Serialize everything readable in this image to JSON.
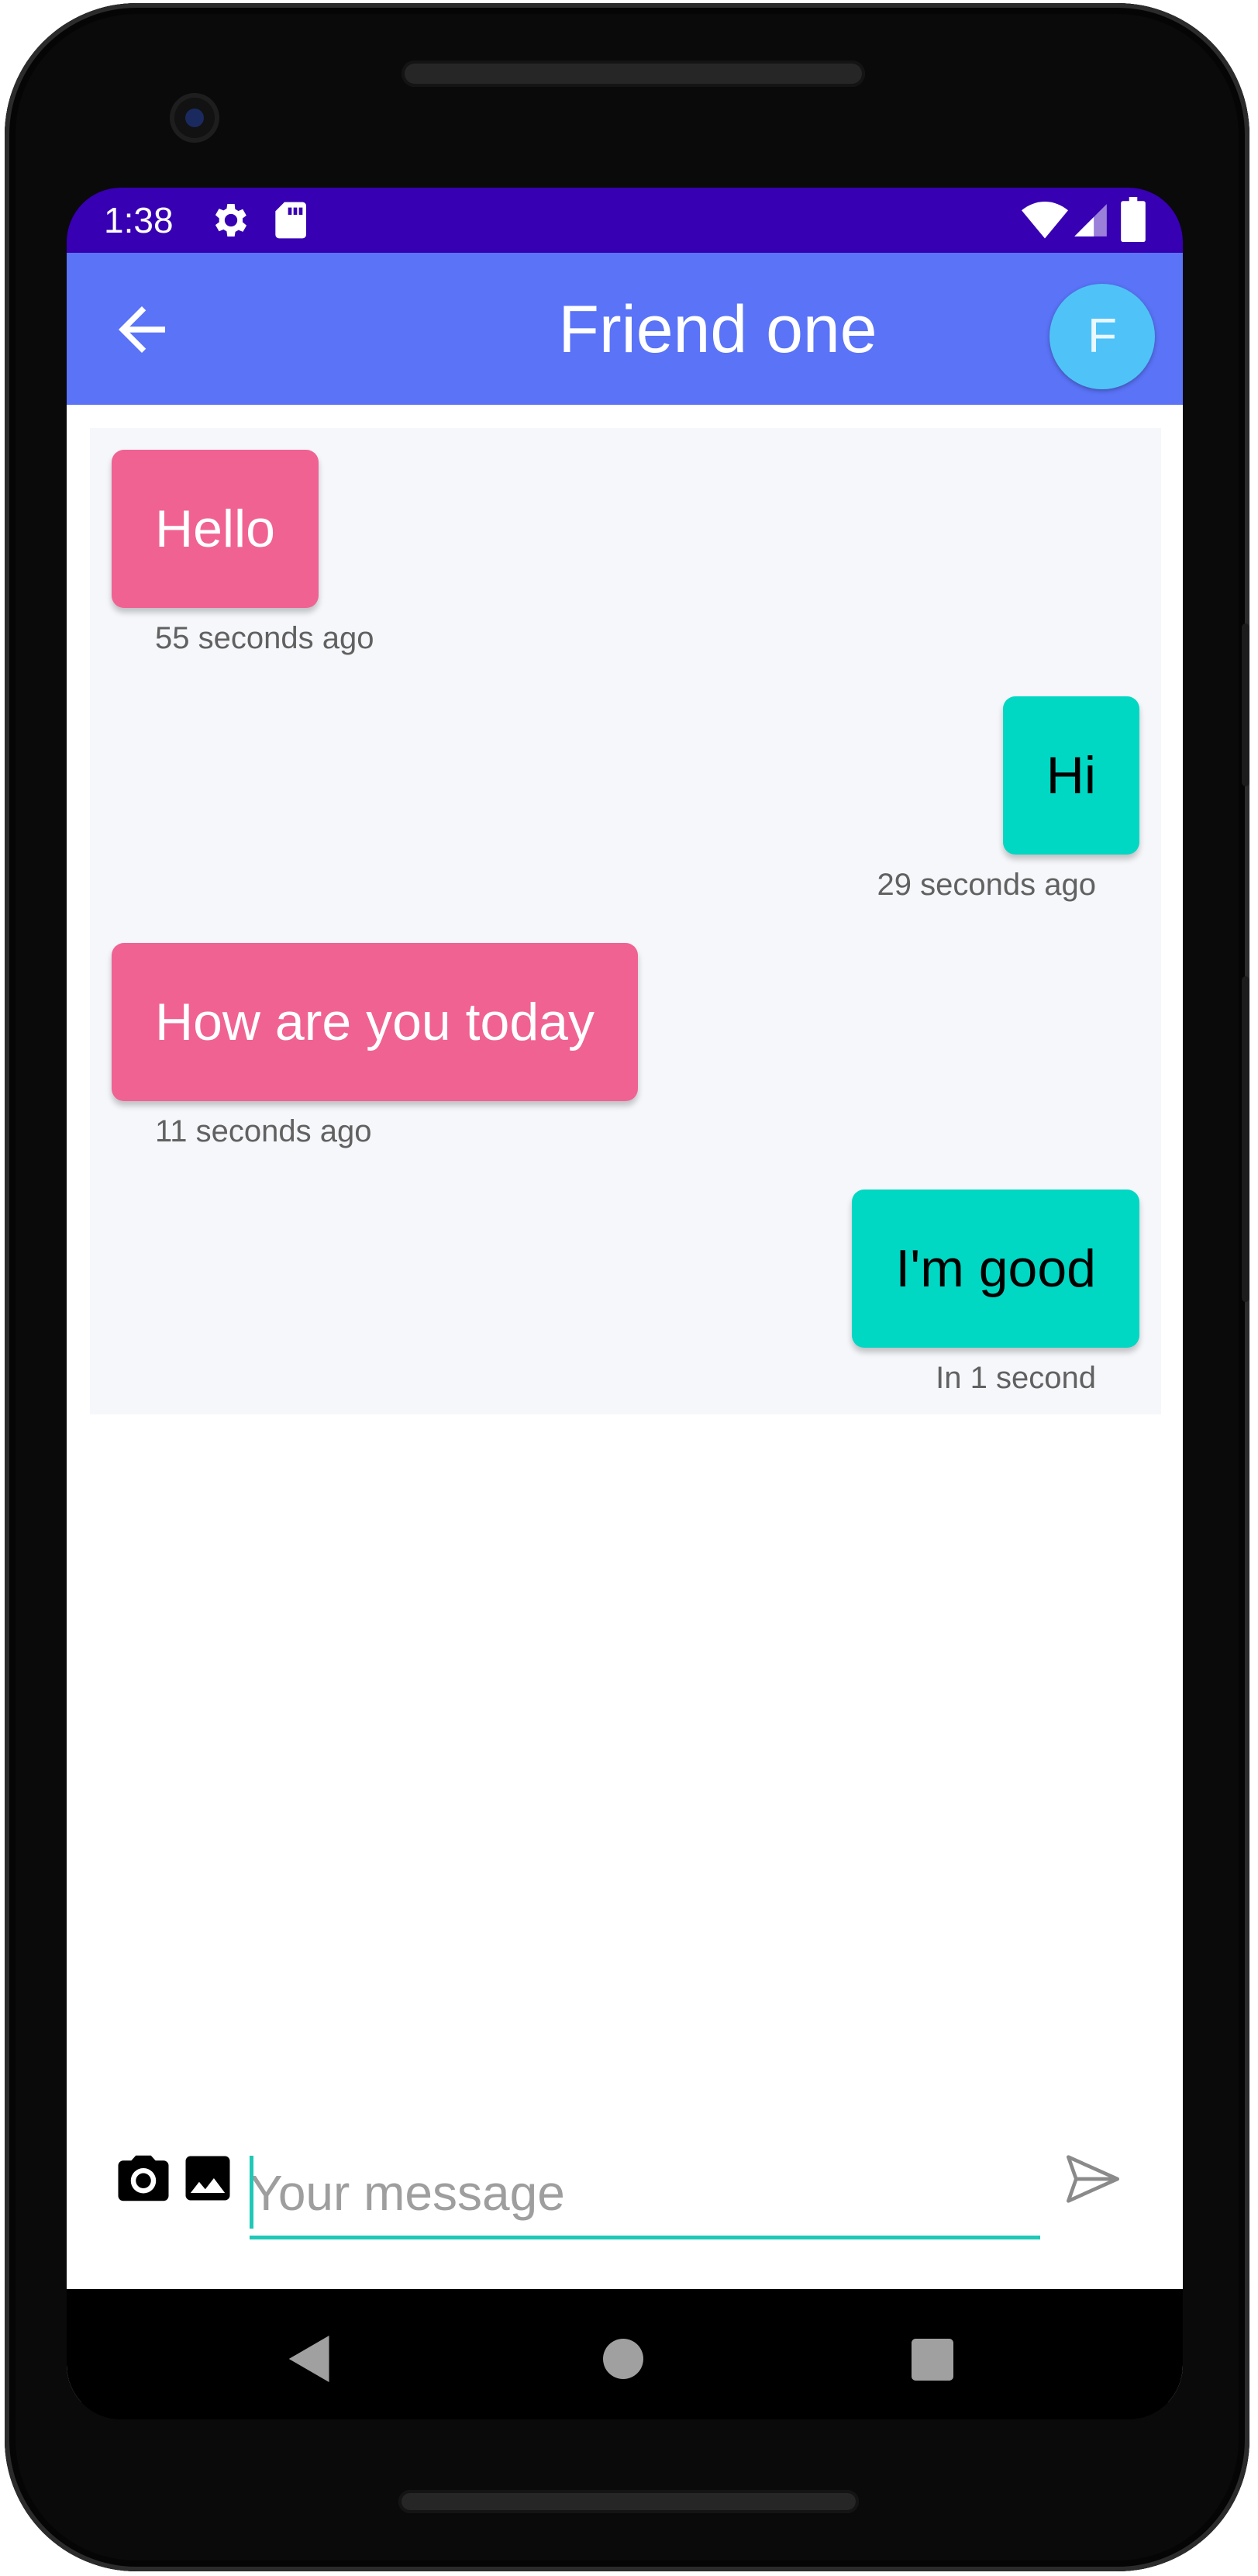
{
  "status_bar": {
    "time": "1:38",
    "background": "#3700b3"
  },
  "app_bar": {
    "title": "Friend one",
    "avatar_initial": "F",
    "background": "#5a73f7",
    "avatar_color": "#4fc3f7"
  },
  "messages": [
    {
      "text": "Hello",
      "time": "55 seconds ago",
      "direction": "incoming"
    },
    {
      "text": "Hi",
      "time": "29 seconds ago",
      "direction": "outgoing"
    },
    {
      "text": "How are you today",
      "time": "11 seconds ago",
      "direction": "incoming"
    },
    {
      "text": "I'm good",
      "time": "In 1 second",
      "direction": "outgoing"
    }
  ],
  "colors": {
    "incoming_bubble": "#f06292",
    "outgoing_bubble": "#00d8c4",
    "input_underline": "#1ec9b7"
  },
  "composer": {
    "placeholder": "Your message",
    "value": ""
  },
  "icons": {
    "back": "arrow-left-icon",
    "camera": "camera-icon",
    "gallery": "image-icon",
    "send": "send-icon"
  }
}
